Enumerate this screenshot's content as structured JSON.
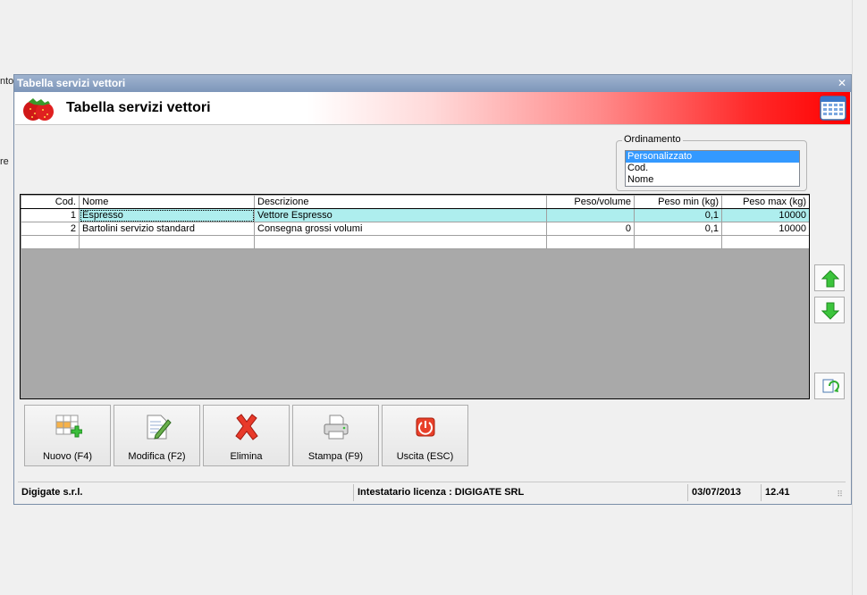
{
  "background": {
    "frag1": "nto",
    "frag2": "re"
  },
  "window": {
    "title": "Tabella servizi vettori",
    "header_title": "Tabella servizi vettori",
    "close_glyph": "✕"
  },
  "ordinamento": {
    "legend": "Ordinamento",
    "options": [
      "Personalizzato",
      "Cod.",
      "Nome"
    ],
    "selected": "Personalizzato"
  },
  "table": {
    "columns": [
      "Cod.",
      "Nome",
      "Descrizione",
      "Peso/volume",
      "Peso min (kg)",
      "Peso max (kg)"
    ],
    "rows": [
      {
        "cod": "1",
        "nome": "Espresso",
        "descrizione": "Vettore Espresso",
        "peso_volume": "",
        "peso_min": "0,1",
        "peso_max": "10000"
      },
      {
        "cod": "2",
        "nome": "Bartolini servizio standard",
        "descrizione": "Consegna grossi volumi",
        "peso_volume": "0",
        "peso_min": "0,1",
        "peso_max": "10000"
      }
    ]
  },
  "toolbar": {
    "nuovo": "Nuovo (F4)",
    "modifica": "Modifica (F2)",
    "elimina": "Elimina",
    "stampa": "Stampa (F9)",
    "uscita": "Uscita (ESC)"
  },
  "status": {
    "company": "Digigate s.r.l.",
    "license": "Intestatario licenza : DIGIGATE SRL",
    "date": "03/07/2013",
    "time": "12.41"
  },
  "icons": {
    "up": "arrow-up-icon",
    "down": "arrow-down-icon",
    "refresh": "refresh-icon",
    "calendar": "calendar-icon",
    "logo": "strawberry-logo"
  },
  "colors": {
    "selected_row": "#aeeeee",
    "list_selection": "#3399ff",
    "header_gradient_end": "#ff0000"
  }
}
